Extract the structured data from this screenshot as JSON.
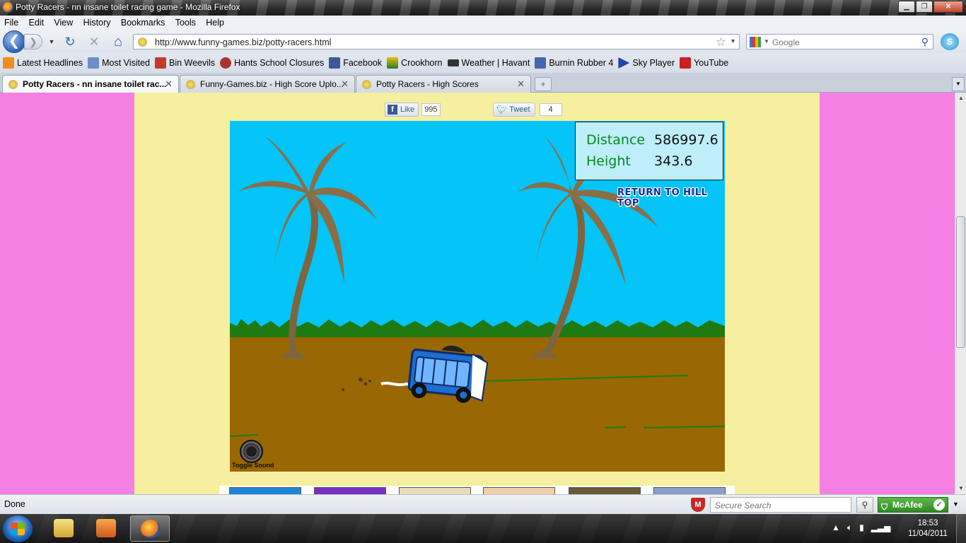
{
  "window": {
    "title": "Potty Racers - nn insane toilet racing game - Mozilla Firefox",
    "minimize": "▁",
    "maximize": "❐",
    "close": "✕"
  },
  "menu": [
    "File",
    "Edit",
    "View",
    "History",
    "Bookmarks",
    "Tools",
    "Help"
  ],
  "nav": {
    "back": "❮",
    "forward": "❯",
    "reload": "↻",
    "stop": "✕",
    "home": "⌂",
    "url": "http://www.funny-games.biz/potty-racers.html",
    "search_placeholder": "Google"
  },
  "bookmarks": [
    {
      "label": "Latest Headlines",
      "color": "#f08c1e"
    },
    {
      "label": "Most Visited",
      "color": "#6b8fc8"
    },
    {
      "label": "Bin Weevils",
      "color": "#c23b2a"
    },
    {
      "label": "Hants School Closures",
      "color": "#a33"
    },
    {
      "label": "Facebook",
      "color": "#3b5998"
    },
    {
      "label": "Crookhorn",
      "color": "#2b7a2b"
    },
    {
      "label": "Weather | Havant",
      "color": "#333"
    },
    {
      "label": "Burnin Rubber 4",
      "color": "#4466aa"
    },
    {
      "label": "Sky Player",
      "color": "#2244aa"
    },
    {
      "label": "YouTube",
      "color": "#cc1f1f"
    }
  ],
  "tabs": [
    {
      "label": "Potty Racers - nn insane toilet rac..."
    },
    {
      "label": "Funny-Games.biz - High Score Uplo..."
    },
    {
      "label": "Potty Racers - High Scores"
    }
  ],
  "social": {
    "like_label": "Like",
    "like_count": "995",
    "tweet_label": "Tweet",
    "tweet_count": "4"
  },
  "game": {
    "distance_label": "Distance",
    "distance_value": "586997.6",
    "height_label": "Height",
    "height_value": "343.6",
    "return_label": "RETURN TO HILL TOP",
    "sound_label": "Toggle Sound"
  },
  "status": {
    "text": "Done",
    "secure_search_placeholder": "Secure Search",
    "mcafee_label": "McAfee"
  },
  "taskbar": {
    "time": "18:53",
    "date": "11/04/2011"
  }
}
